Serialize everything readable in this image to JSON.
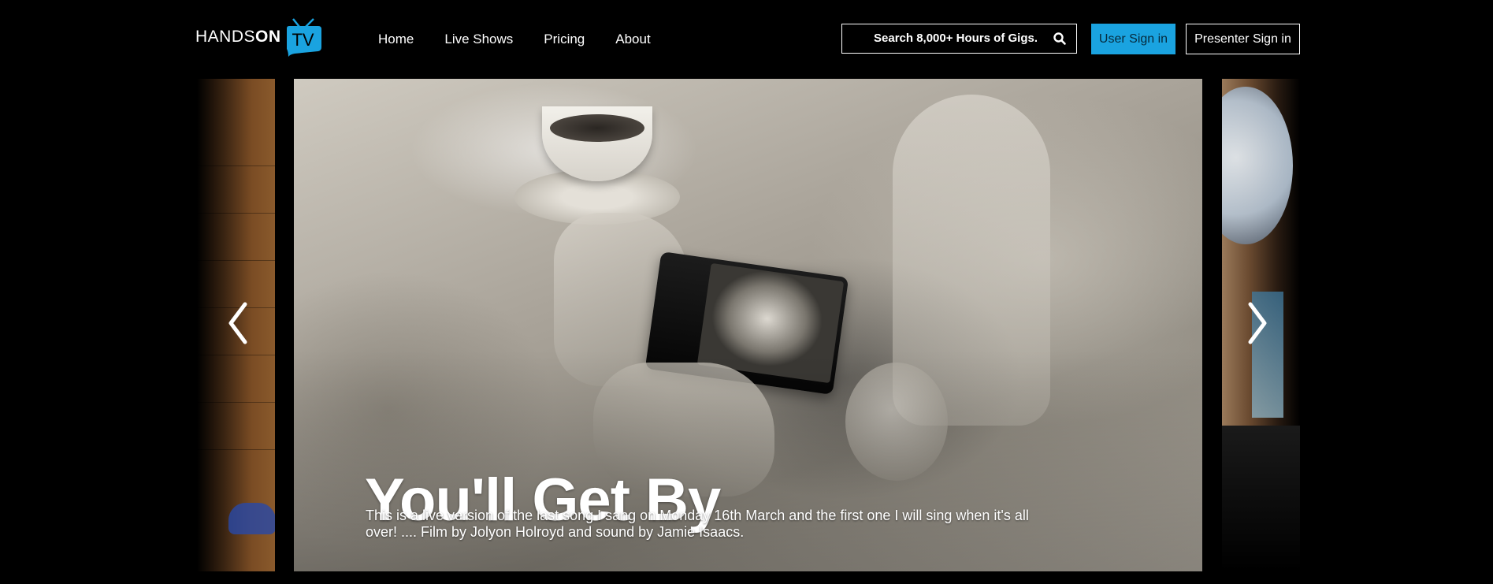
{
  "brand": {
    "name_light": "HANDS",
    "name_bold": "ON",
    "badge": "TV",
    "accent_color": "#1aa3e0"
  },
  "nav": {
    "items": [
      {
        "label": "Home"
      },
      {
        "label": "Live Shows"
      },
      {
        "label": "Pricing"
      },
      {
        "label": "About"
      }
    ]
  },
  "search": {
    "placeholder": "Search 8,000+ Hours of Gigs.",
    "icon": "search-icon"
  },
  "auth": {
    "user_sign_in": "User Sign in",
    "presenter_sign_in": "Presenter Sign in"
  },
  "carousel": {
    "slide": {
      "title": "You'll Get By",
      "description": "This is a live version of the last song I sang on Monday 16th March and the first one I will sing when it's all over! .... Film by Jolyon Holroyd and sound by Jamie Isaacs."
    },
    "prev_icon": "chevron-left-icon",
    "next_icon": "chevron-right-icon"
  }
}
